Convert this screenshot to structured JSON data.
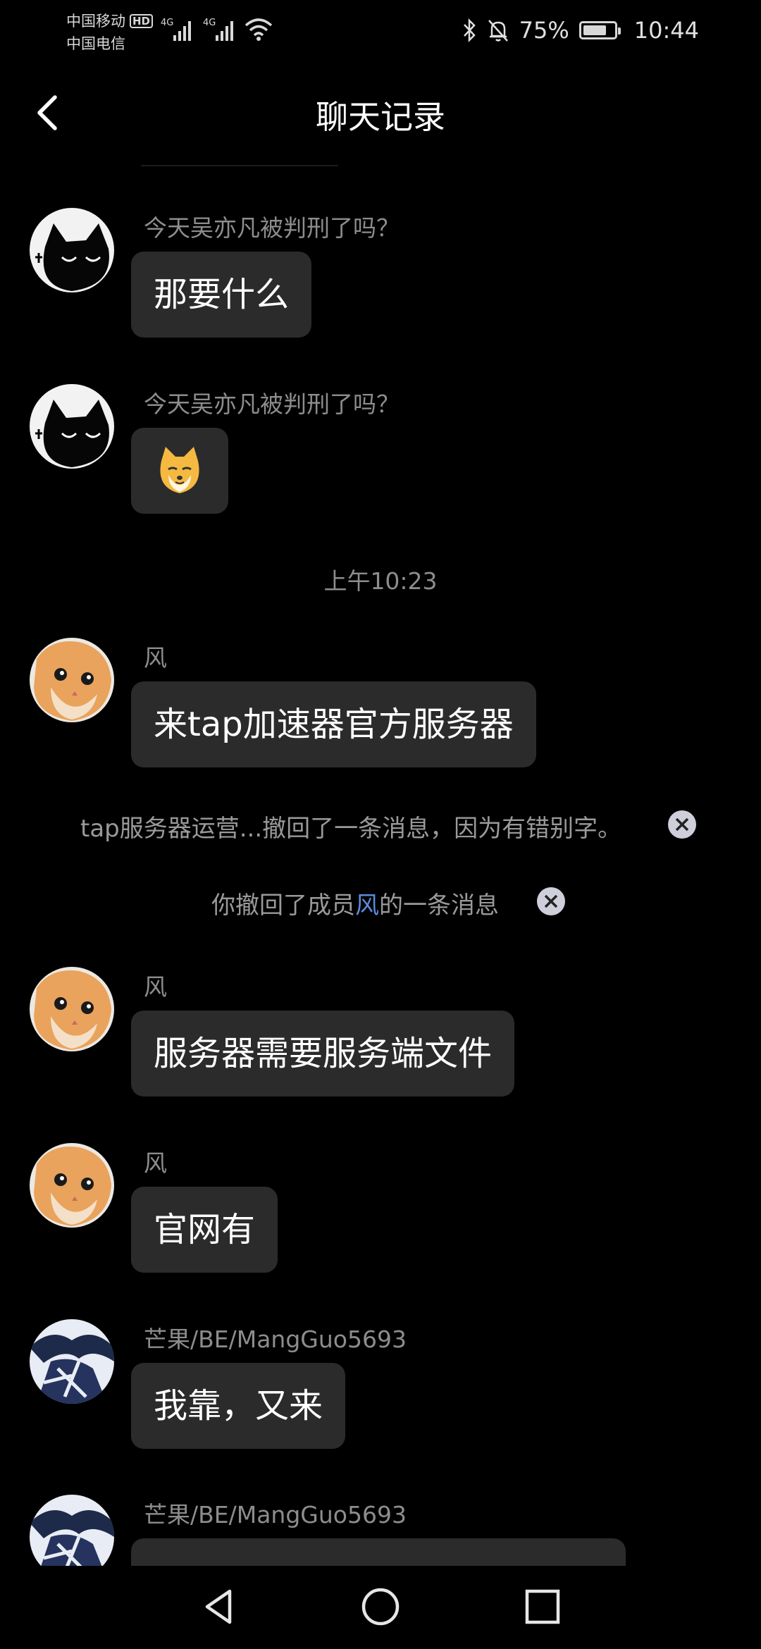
{
  "status_bar": {
    "carrier1": "中国移动",
    "hd": "HD",
    "carrier2": "中国电信",
    "net1": "4G",
    "net2": "4G",
    "battery": "75%",
    "battery_level": 0.75,
    "time": "10:44"
  },
  "header": {
    "title": "聊天记录"
  },
  "messages": [
    {
      "sender": "今天吴亦凡被判刑了吗？",
      "text": "那要什么",
      "avatar": "black-cat"
    },
    {
      "sender": "今天吴亦凡被判刑了吗？",
      "text": "",
      "emoji": "shiba-sticker",
      "avatar": "black-cat"
    },
    {
      "sender": "风",
      "text": "来tap加速器官方服务器",
      "avatar": "orange-cat"
    },
    {
      "sender": "风",
      "text": "服务器需要服务端文件",
      "avatar": "orange-cat"
    },
    {
      "sender": "风",
      "text": "官网有",
      "avatar": "orange-cat"
    },
    {
      "sender": "芒果/BE/MangGuo5693",
      "text": "我靠，又来",
      "avatar": "anime"
    },
    {
      "sender": "芒果/BE/MangGuo5693",
      "text": "",
      "avatar": "anime"
    }
  ],
  "timestamp": "上午10:23",
  "system_notices": [
    {
      "text": "tap服务器运营...撤回了一条消息，因为有错别字。"
    },
    {
      "prefix": "你撤回了成员",
      "highlight": "风",
      "suffix": "的一条消息"
    }
  ],
  "colors": {
    "background": "#000000",
    "bubble": "#2b2b2b",
    "sender_text": "#8d8d8d",
    "highlight": "#5b8bdb"
  }
}
